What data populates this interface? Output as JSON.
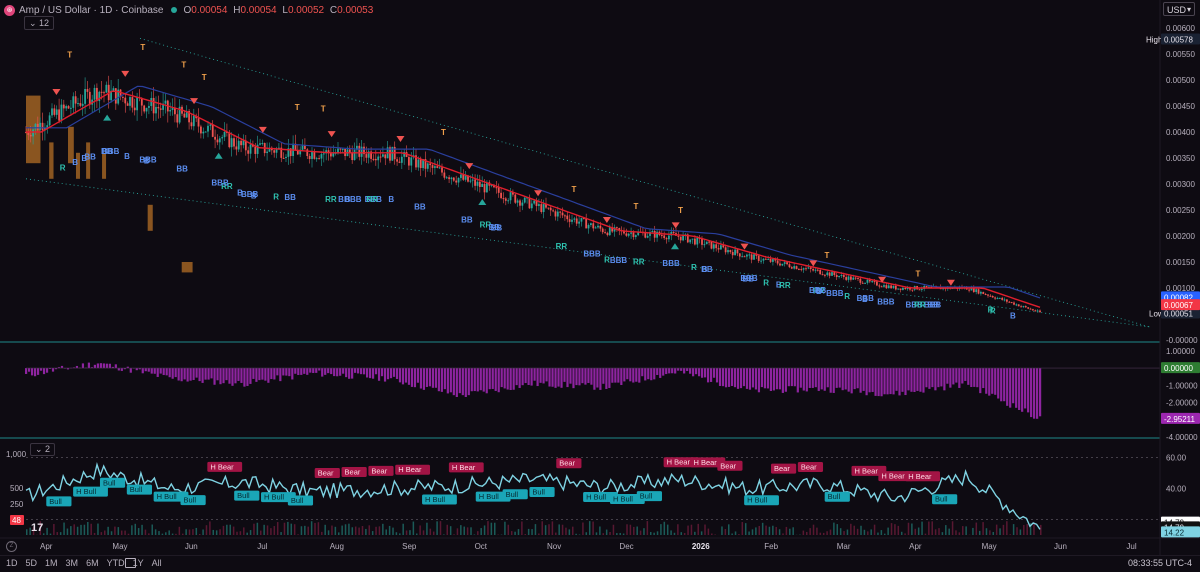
{
  "header": {
    "symbol": "Amp / US Dollar · 1D · Coinbase",
    "logo_icon": "amp-logo-icon",
    "open_label": "O",
    "open_value": "0.00054",
    "high_label": "H",
    "high_value": "0.00054",
    "low_label": "L",
    "low_value": "0.00052",
    "close_label": "C",
    "close_value": "0.00053",
    "indicators_collapse": "12",
    "pane3_collapse": "2"
  },
  "currency": "USD",
  "price_axis": {
    "ticks": [
      "0.00600",
      "0.00550",
      "0.00500",
      "0.00450",
      "0.00400",
      "0.00350",
      "0.00300",
      "0.00250",
      "0.00200",
      "0.00150",
      "0.00100",
      "-0.00000"
    ],
    "high_label": "High",
    "high_value": "0.00578",
    "low_label": "Low",
    "low_value": "0.00051",
    "badges": [
      {
        "text": "0.00082",
        "color": "#2962ff"
      },
      {
        "text": "0.00067",
        "color": "#f23645"
      }
    ]
  },
  "osc_axis": {
    "ticks": [
      "1.00000",
      "-1.00000",
      "-2.00000",
      "-4.00000"
    ],
    "badge_zero": "0.00000",
    "badge_last": "-2.95211"
  },
  "rsi_axis": {
    "right_ticks": [
      "60.00",
      "40.00"
    ],
    "right_badges": [
      "14.79",
      "14.79",
      "14.22"
    ],
    "left_ticks": [
      "1,000",
      "500",
      "250"
    ],
    "left_badge": "48"
  },
  "time_axis": [
    "Apr",
    "May",
    "Jun",
    "Jul",
    "Aug",
    "Sep",
    "Oct",
    "Nov",
    "Dec",
    "2026",
    "Feb",
    "Mar",
    "Apr",
    "May",
    "Jun",
    "Jul"
  ],
  "range_buttons": [
    "1D",
    "5D",
    "1M",
    "3M",
    "6M",
    "YTD",
    "1Y",
    "All"
  ],
  "clock": "08:33:55 UTC-4",
  "colors": {
    "up": "#26a69a",
    "down": "#ef5350",
    "osc": "#9c27b0",
    "rsi": "#7fd3e3",
    "ma_red": "#e01e2d",
    "ma_blue": "#2a3f9d",
    "zone": "#f0932b",
    "bear": "#a31445",
    "bull": "#1aa6b7"
  },
  "chart_data": [
    {
      "type": "line",
      "title": "",
      "ylim": [
        0,
        0.006
      ],
      "x": [
        "Apr",
        "May",
        "Jun",
        "Jul",
        "Aug",
        "Sep",
        "Oct",
        "Nov",
        "Dec",
        "2026",
        "Feb",
        "Mar",
        "Apr",
        "May",
        "Jun"
      ],
      "series": [
        {
          "values": [
            0.004,
            0.0048,
            0.0044,
            0.0037,
            0.0036,
            0.0036,
            0.0031,
            0.0026,
            0.0021,
            0.002,
            0.0016,
            0.0013,
            0.001,
            0.001,
            0.00053
          ]
        }
      ],
      "reference_lines": {
        "high": 0.00578,
        "low": 0.00051
      },
      "signal_labels": [
        "T",
        "R",
        "B",
        "RR",
        "BB",
        "BBB"
      ]
    },
    {
      "type": "bar",
      "title": "",
      "ylim": [
        -4,
        1.4
      ],
      "x": [
        "Apr",
        "May",
        "Jun",
        "Jul",
        "Aug",
        "Sep",
        "Oct",
        "Nov",
        "Dec",
        "2026",
        "Feb",
        "Mar",
        "Apr",
        "May",
        "Jun"
      ],
      "series": [
        {
          "values": [
            -0.4,
            0.3,
            -0.6,
            -0.9,
            -0.3,
            -0.6,
            -1.6,
            -0.9,
            -1.1,
            -0.2,
            -1.3,
            -1.2,
            -1.5,
            -0.9,
            -2.95
          ]
        }
      ]
    },
    {
      "type": "line",
      "title": "",
      "ylim": [
        10,
        70
      ],
      "x": [
        "Apr",
        "May",
        "Jun",
        "Jul",
        "Aug",
        "Sep",
        "Oct",
        "Nov",
        "Dec",
        "2026",
        "Feb",
        "Mar",
        "Apr",
        "May",
        "Jun"
      ],
      "series": [
        {
          "values": [
            35,
            52,
            40,
            44,
            38,
            40,
            42,
            46,
            41,
            46,
            40,
            43,
            34,
            48,
            14.22
          ]
        }
      ],
      "annotations": [
        "H Bear",
        "Bear",
        "H Bull",
        "Bull"
      ]
    }
  ]
}
